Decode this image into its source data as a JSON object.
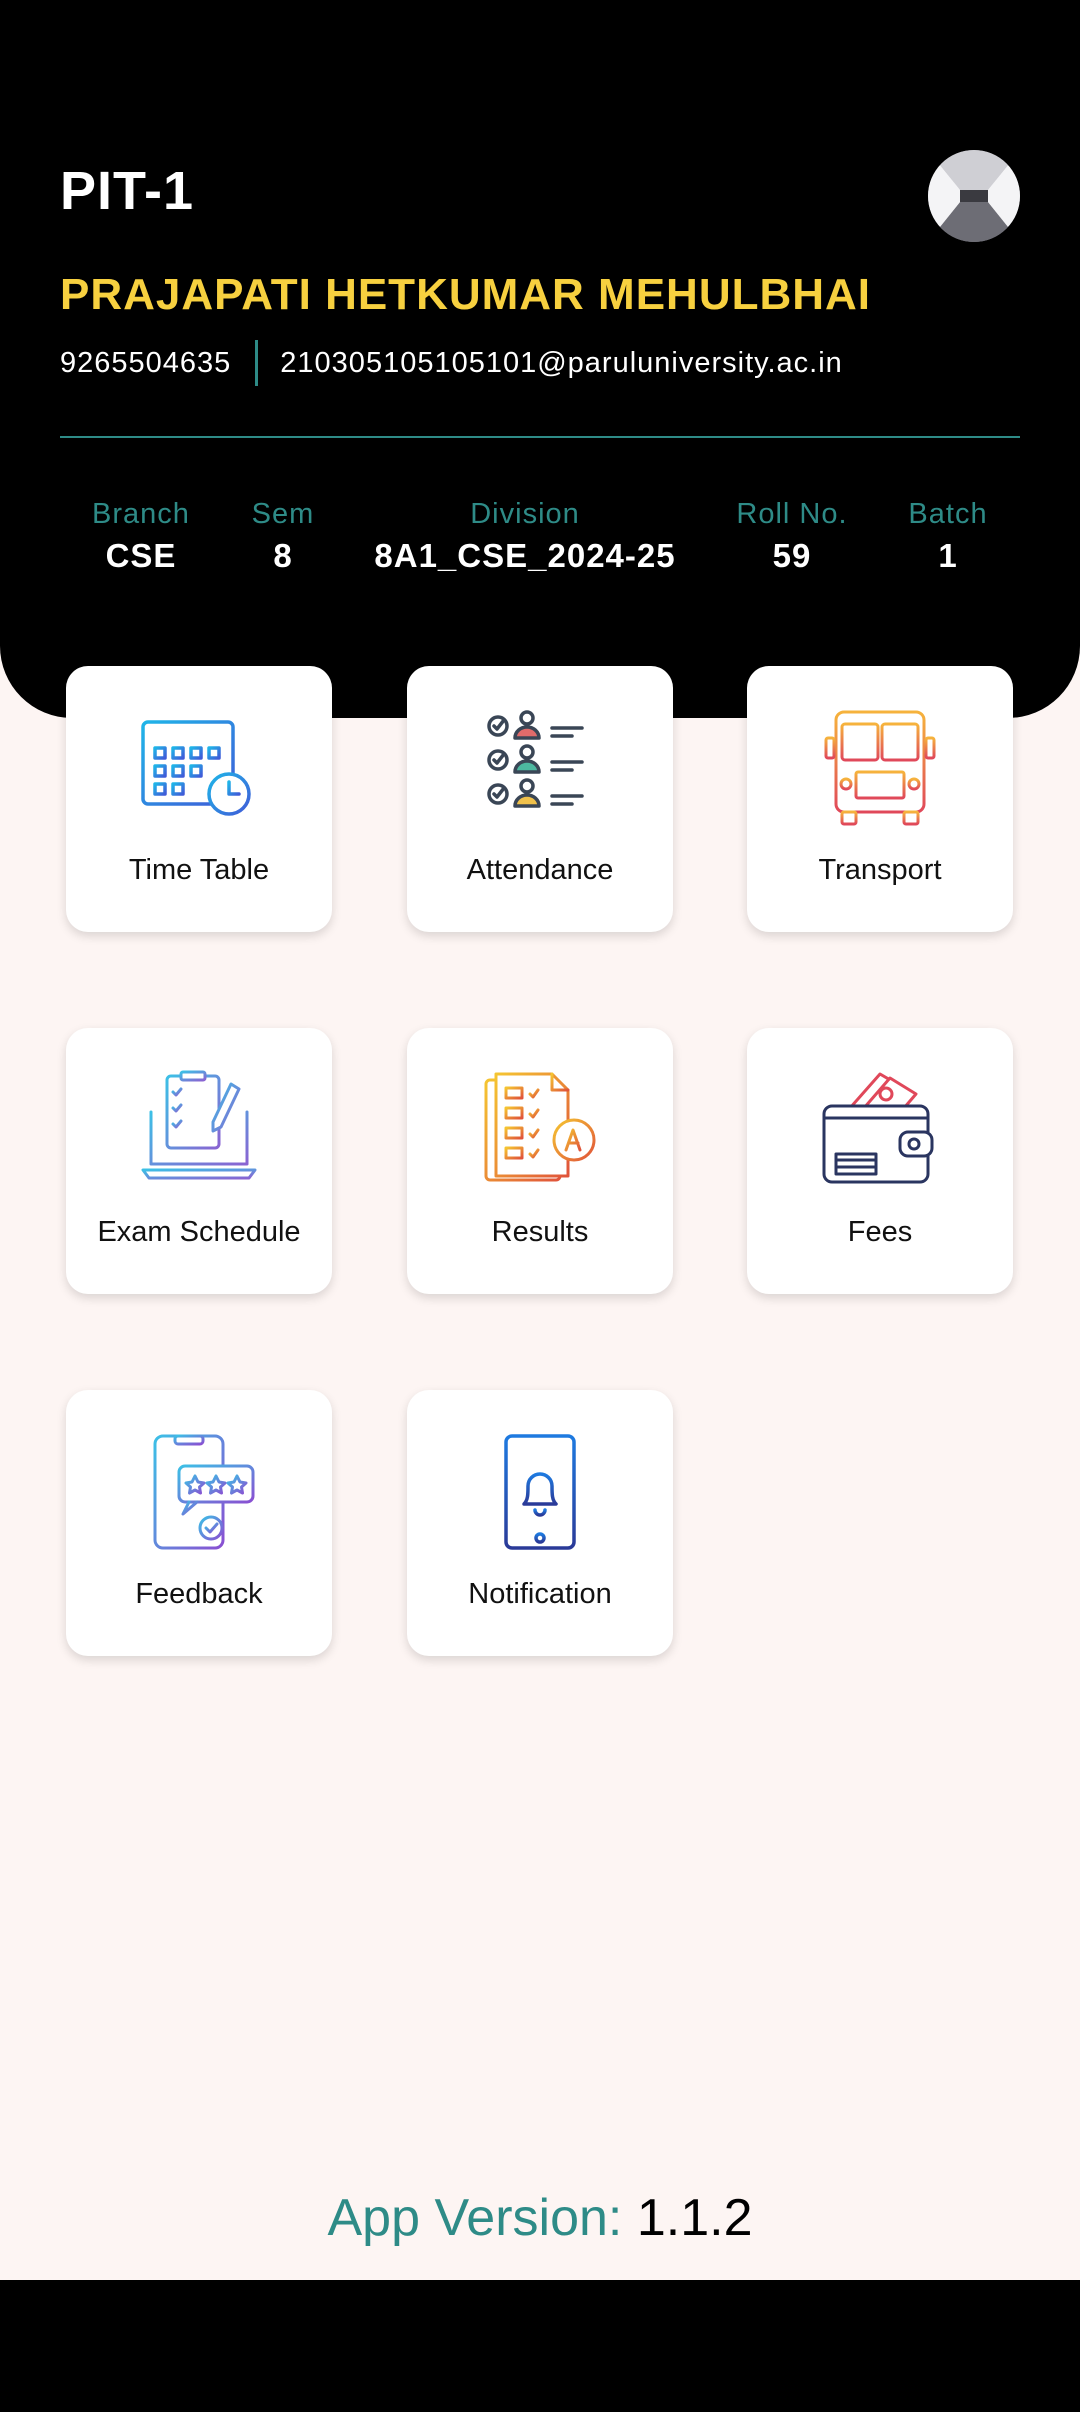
{
  "header": {
    "app_title": "PIT-1",
    "student_name": "PRAJAPATI HETKUMAR MEHULBHAI",
    "phone": "9265504635",
    "email": "210305105105101@paruluniversity.ac.in",
    "avatar_icon": "profile-photo",
    "info": {
      "branch": {
        "label": "Branch",
        "value": "CSE"
      },
      "sem": {
        "label": "Sem",
        "value": "8"
      },
      "division": {
        "label": "Division",
        "value": "8A1_CSE_2024-25"
      },
      "roll": {
        "label": "Roll No.",
        "value": "59"
      },
      "batch": {
        "label": "Batch",
        "value": "1"
      }
    }
  },
  "menu": [
    {
      "label": "Time Table",
      "icon": "calendar-clock-icon"
    },
    {
      "label": "Attendance",
      "icon": "attendance-checklist-icon"
    },
    {
      "label": "Transport",
      "icon": "bus-icon"
    },
    {
      "label": "Exam Schedule",
      "icon": "laptop-checklist-icon"
    },
    {
      "label": "Results",
      "icon": "grade-report-icon"
    },
    {
      "label": "Fees",
      "icon": "wallet-icon"
    },
    {
      "label": "Feedback",
      "icon": "rating-feedback-icon"
    },
    {
      "label": "Notification",
      "icon": "phone-bell-icon"
    }
  ],
  "footer": {
    "version_label": "App Version:",
    "version_number": "1.1.2"
  },
  "colors": {
    "accent": "#2e8b87",
    "name": "#f7d03f",
    "header_bg": "#000000",
    "page_bg": "#fdf5f3"
  }
}
